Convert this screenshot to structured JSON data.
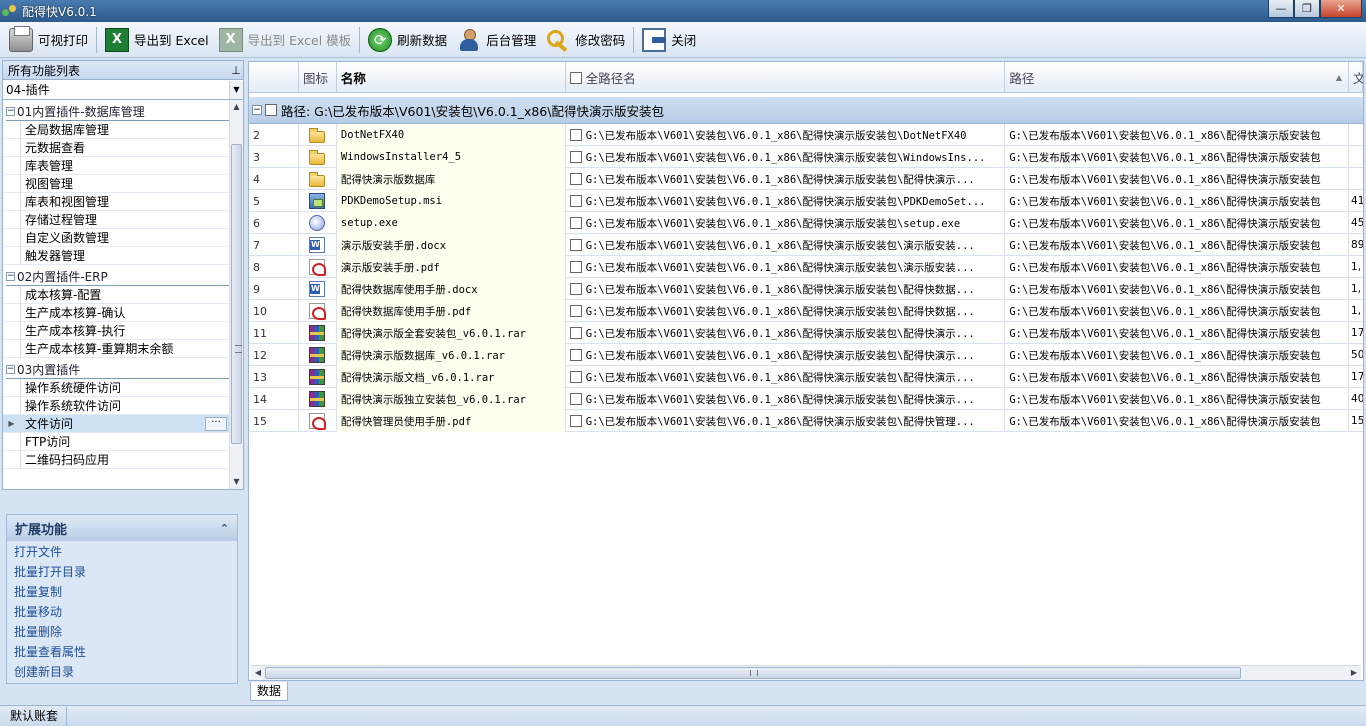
{
  "window": {
    "title": "配得快V6.0.1",
    "minimize_icon": "minimize-icon",
    "maximize_icon": "maximize-icon",
    "close_icon": "close-icon"
  },
  "toolbar": {
    "print": "可视打印",
    "export_excel": "导出到 Excel",
    "export_template": "导出到 Excel 模板",
    "refresh": "刷新数据",
    "admin": "后台管理",
    "change_password": "修改密码",
    "close": "关闭",
    "icons": [
      "printer-icon",
      "excel-icon",
      "excel-template-icon",
      "refresh-icon",
      "admin-user-icon",
      "key-icon",
      "exit-icon"
    ]
  },
  "sidebar": {
    "header": "所有功能列表",
    "pin_glyph": "⊥",
    "module_selected": "04-插件",
    "groups": [
      {
        "label": "01内置插件-数据库管理",
        "items": [
          "全局数据库管理",
          "元数据查看",
          "库表管理",
          "视图管理",
          "库表和视图管理",
          "存储过程管理",
          "自定义函数管理",
          "触发器管理"
        ]
      },
      {
        "label": "02内置插件-ERP",
        "items": [
          "成本核算-配置",
          "生产成本核算-确认",
          "生产成本核算-执行",
          "生产成本核算-重算期末余额"
        ]
      },
      {
        "label": "03内置插件",
        "items": [
          "操作系统硬件访问",
          "操作系统软件访问",
          "文件访问",
          "FTP访问",
          "二维码扫码应用"
        ]
      }
    ],
    "selected_item": "文件访问",
    "more_button": "···"
  },
  "extensions": {
    "title": "扩展功能",
    "items": [
      "打开文件",
      "批量打开目录",
      "批量复制",
      "批量移动",
      "批量删除",
      "批量查看属性",
      "创建新目录"
    ]
  },
  "grid": {
    "columns": {
      "icon": "图标",
      "name": "名称",
      "full_path_name": "全路径名",
      "path": "路径",
      "extra": "文"
    },
    "group_label": "路径: G:\\已发布版本\\V601\\安装包\\V6.0.1_x86\\配得快演示版安装包",
    "rows": [
      {
        "no": "2",
        "icon": "folder-icon",
        "name": "DotNetFX40",
        "full": "G:\\已发布版本\\V601\\安装包\\V6.0.1_x86\\配得快演示版安装包\\DotNetFX40",
        "path": "G:\\已发布版本\\V601\\安装包\\V6.0.1_x86\\配得快演示版安装包",
        "extra": ""
      },
      {
        "no": "3",
        "icon": "folder-icon",
        "name": "WindowsInstaller4_5",
        "full": "G:\\已发布版本\\V601\\安装包\\V6.0.1_x86\\配得快演示版安装包\\WindowsIns...",
        "path": "G:\\已发布版本\\V601\\安装包\\V6.0.1_x86\\配得快演示版安装包",
        "extra": ""
      },
      {
        "no": "4",
        "icon": "folder-icon",
        "name": "配得快演示版数据库",
        "full": "G:\\已发布版本\\V601\\安装包\\V6.0.1_x86\\配得快演示版安装包\\配得快演示...",
        "path": "G:\\已发布版本\\V601\\安装包\\V6.0.1_x86\\配得快演示版安装包",
        "extra": ""
      },
      {
        "no": "5",
        "icon": "msi-installer-icon",
        "name": "PDKDemoSetup.msi",
        "full": "G:\\已发布版本\\V601\\安装包\\V6.0.1_x86\\配得快演示版安装包\\PDKDemoSet...",
        "path": "G:\\已发布版本\\V601\\安装包\\V6.0.1_x86\\配得快演示版安装包",
        "extra": "41"
      },
      {
        "no": "6",
        "icon": "exe-setup-icon",
        "name": "setup.exe",
        "full": "G:\\已发布版本\\V601\\安装包\\V6.0.1_x86\\配得快演示版安装包\\setup.exe",
        "path": "G:\\已发布版本\\V601\\安装包\\V6.0.1_x86\\配得快演示版安装包",
        "extra": "45"
      },
      {
        "no": "7",
        "icon": "word-doc-icon",
        "name": "演示版安装手册.docx",
        "full": "G:\\已发布版本\\V601\\安装包\\V6.0.1_x86\\配得快演示版安装包\\演示版安装...",
        "path": "G:\\已发布版本\\V601\\安装包\\V6.0.1_x86\\配得快演示版安装包",
        "extra": "89"
      },
      {
        "no": "8",
        "icon": "pdf-icon",
        "name": "演示版安装手册.pdf",
        "full": "G:\\已发布版本\\V601\\安装包\\V6.0.1_x86\\配得快演示版安装包\\演示版安装...",
        "path": "G:\\已发布版本\\V601\\安装包\\V6.0.1_x86\\配得快演示版安装包",
        "extra": "1,"
      },
      {
        "no": "9",
        "icon": "word-doc-icon",
        "name": "配得快数据库使用手册.docx",
        "full": "G:\\已发布版本\\V601\\安装包\\V6.0.1_x86\\配得快演示版安装包\\配得快数据...",
        "path": "G:\\已发布版本\\V601\\安装包\\V6.0.1_x86\\配得快演示版安装包",
        "extra": "1,"
      },
      {
        "no": "10",
        "icon": "pdf-icon",
        "name": "配得快数据库使用手册.pdf",
        "full": "G:\\已发布版本\\V601\\安装包\\V6.0.1_x86\\配得快演示版安装包\\配得快数据...",
        "path": "G:\\已发布版本\\V601\\安装包\\V6.0.1_x86\\配得快演示版安装包",
        "extra": "1,"
      },
      {
        "no": "11",
        "icon": "rar-archive-icon",
        "name": "配得快演示版全套安装包_v6.0.1.rar",
        "full": "G:\\已发布版本\\V601\\安装包\\V6.0.1_x86\\配得快演示版安装包\\配得快演示...",
        "path": "G:\\已发布版本\\V601\\安装包\\V6.0.1_x86\\配得快演示版安装包",
        "extra": "17"
      },
      {
        "no": "12",
        "icon": "rar-archive-icon",
        "name": "配得快演示版数据库_v6.0.1.rar",
        "full": "G:\\已发布版本\\V601\\安装包\\V6.0.1_x86\\配得快演示版安装包\\配得快演示...",
        "path": "G:\\已发布版本\\V601\\安装包\\V6.0.1_x86\\配得快演示版安装包",
        "extra": "50"
      },
      {
        "no": "13",
        "icon": "rar-archive-icon",
        "name": "配得快演示版文档_v6.0.1.rar",
        "full": "G:\\已发布版本\\V601\\安装包\\V6.0.1_x86\\配得快演示版安装包\\配得快演示...",
        "path": "G:\\已发布版本\\V601\\安装包\\V6.0.1_x86\\配得快演示版安装包",
        "extra": "17"
      },
      {
        "no": "14",
        "icon": "rar-archive-icon",
        "name": "配得快演示版独立安装包_v6.0.1.rar",
        "full": "G:\\已发布版本\\V601\\安装包\\V6.0.1_x86\\配得快演示版安装包\\配得快演示...",
        "path": "G:\\已发布版本\\V601\\安装包\\V6.0.1_x86\\配得快演示版安装包",
        "extra": "40"
      },
      {
        "no": "15",
        "icon": "pdf-icon",
        "name": "配得快管理员使用手册.pdf",
        "full": "G:\\已发布版本\\V601\\安装包\\V6.0.1_x86\\配得快演示版安装包\\配得快管理...",
        "path": "G:\\已发布版本\\V601\\安装包\\V6.0.1_x86\\配得快演示版安装包",
        "extra": "15"
      }
    ]
  },
  "tabs": {
    "data_tab": "数据"
  },
  "status": {
    "account": "默认账套"
  }
}
